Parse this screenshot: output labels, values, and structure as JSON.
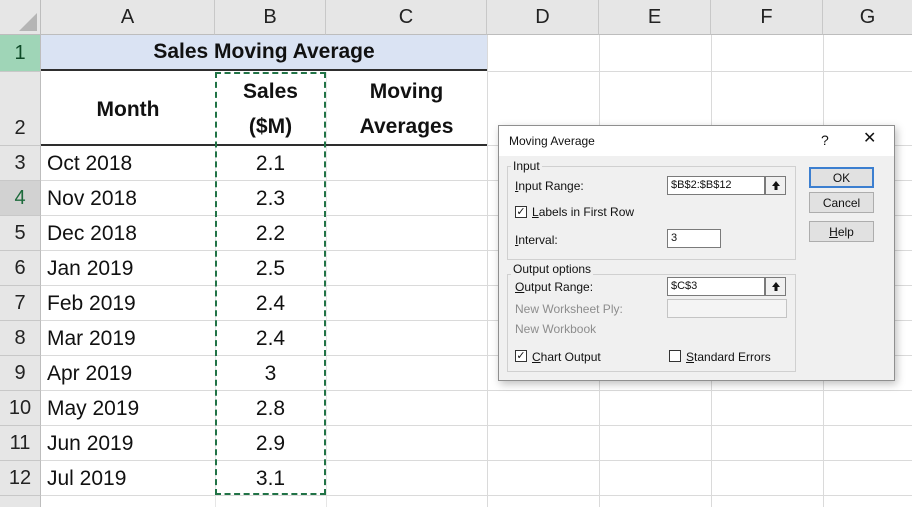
{
  "columns": [
    "A",
    "B",
    "C",
    "D",
    "E",
    "F",
    "G"
  ],
  "rows": [
    "1",
    "2",
    "3",
    "4",
    "5",
    "6",
    "7",
    "8",
    "9",
    "10",
    "11",
    "12"
  ],
  "title": "Sales Moving Average",
  "headers": {
    "month": "Month",
    "sales_line1": "Sales",
    "sales_line2": "($M)",
    "ma_line1": "Moving",
    "ma_line2": "Averages"
  },
  "data": [
    {
      "month": "Oct 2018",
      "sales": "2.1"
    },
    {
      "month": "Nov 2018",
      "sales": "2.3"
    },
    {
      "month": "Dec 2018",
      "sales": "2.2"
    },
    {
      "month": "Jan 2019",
      "sales": "2.5"
    },
    {
      "month": "Feb 2019",
      "sales": "2.4"
    },
    {
      "month": "Mar 2019",
      "sales": "2.4"
    },
    {
      "month": "Apr 2019",
      "sales": "3"
    },
    {
      "month": "May 2019",
      "sales": "2.8"
    },
    {
      "month": "Jun 2019",
      "sales": "2.9"
    },
    {
      "month": "Jul 2019",
      "sales": "3.1"
    }
  ],
  "dialog": {
    "title": "Moving Average",
    "help_glyph": "?",
    "close_glyph": "✕",
    "input_group": "Input",
    "input_range_label": "Input Range:",
    "input_range_value": "$B$2:$B$12",
    "labels_first_row": "Labels in First Row",
    "labels_first_row_checked": true,
    "interval_label": "Interval:",
    "interval_value": "3",
    "output_group": "Output options",
    "output_range_label": "Output Range:",
    "output_range_value": "$C$3",
    "new_ply_label": "New Worksheet Ply:",
    "new_workbook_label": "New Workbook",
    "chart_output": "Chart Output",
    "chart_output_checked": true,
    "standard_errors": "Standard Errors",
    "standard_errors_checked": false,
    "ok": "OK",
    "cancel": "Cancel",
    "help": "Help"
  },
  "colors": {
    "accent_green": "#217346",
    "title_fill": "#dae3f3",
    "selected_row_header": "#9fd5b7"
  }
}
